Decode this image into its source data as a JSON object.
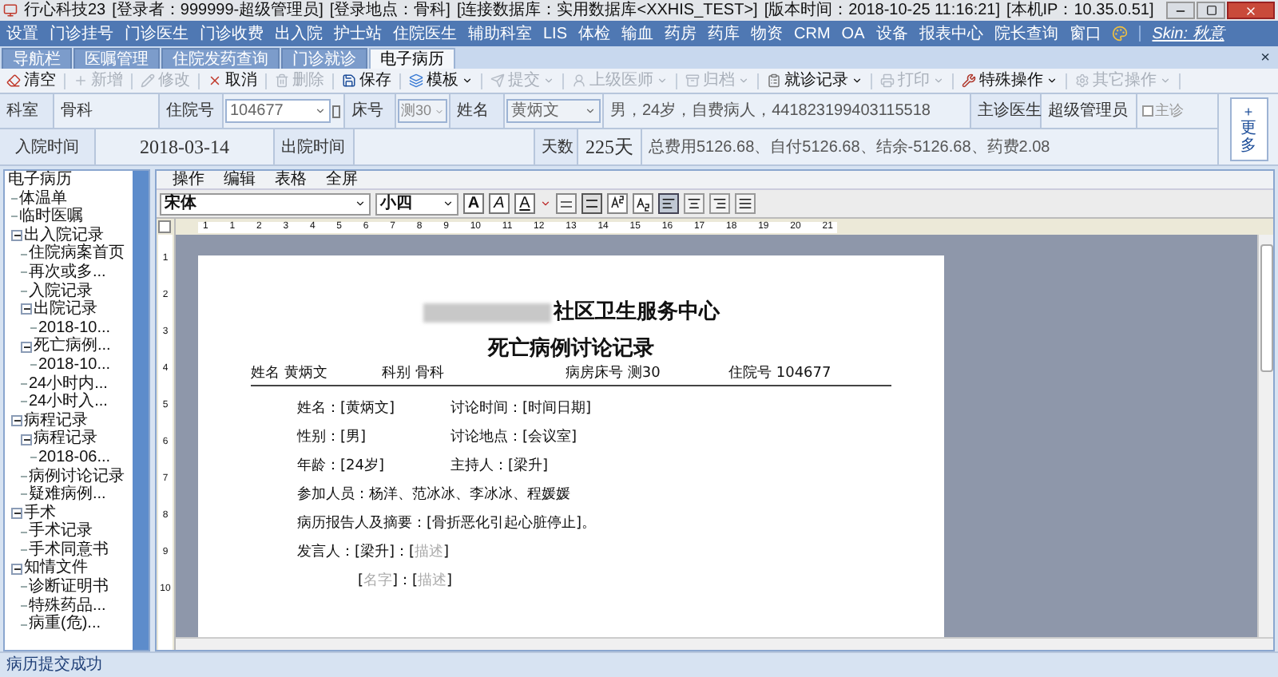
{
  "title_bar": {
    "app": "行心科技23",
    "segments": [
      "[登录者：999999-超级管理员]",
      "[登录地点：骨科]",
      "[连接数据库：实用数据库<XXHIS_TEST>]",
      "[版本时间：2018-10-25 11:16:21]",
      "[本机IP：10.35.0.51]"
    ]
  },
  "menu": [
    "设置",
    "门诊挂号",
    "门诊医生",
    "门诊收费",
    "出入院",
    "护士站",
    "住院医生",
    "辅助科室",
    "LIS",
    "体检",
    "输血",
    "药房",
    "药库",
    "物资",
    "CRM",
    "OA",
    "设备",
    "报表中心",
    "院长查询",
    "窗口"
  ],
  "skin": "Skin: 秋意",
  "tabs": [
    {
      "label": "导航栏",
      "selected": false
    },
    {
      "label": "医嘱管理",
      "selected": false
    },
    {
      "label": "住院发药查询",
      "selected": false
    },
    {
      "label": "门诊就诊",
      "selected": false
    },
    {
      "label": "电子病历",
      "selected": true
    }
  ],
  "tab_close": "×",
  "toolbar": [
    {
      "label": "清空",
      "disabled": false,
      "dropdown": false
    },
    {
      "label": "新增",
      "disabled": true,
      "dropdown": false
    },
    {
      "label": "修改",
      "disabled": true,
      "dropdown": false
    },
    {
      "label": "取消",
      "disabled": false,
      "dropdown": false
    },
    {
      "label": "删除",
      "disabled": true,
      "dropdown": false
    },
    {
      "label": "保存",
      "disabled": false,
      "dropdown": false
    },
    {
      "label": "模板",
      "disabled": false,
      "dropdown": true
    },
    {
      "label": "提交",
      "disabled": true,
      "dropdown": true
    },
    {
      "label": "上级医师",
      "disabled": true,
      "dropdown": true
    },
    {
      "label": "归档",
      "disabled": true,
      "dropdown": true
    },
    {
      "label": "就诊记录",
      "disabled": false,
      "dropdown": true
    },
    {
      "label": "打印",
      "disabled": true,
      "dropdown": true
    },
    {
      "label": "特殊操作",
      "disabled": false,
      "dropdown": true
    },
    {
      "label": "其它操作",
      "disabled": true,
      "dropdown": true
    }
  ],
  "patient": {
    "dept_label": "科室",
    "dept": "骨科",
    "inpatient_no_label": "住院号",
    "inpatient_no": "104677",
    "bed_label": "床号",
    "bed": "测30",
    "name_label": "姓名",
    "name": "黄炳文",
    "summary": "男，24岁，自费病人，441823199403115518",
    "doctor_label": "主诊医生",
    "doctor": "超级管理员",
    "main_checkbox": {
      "label": "主诊",
      "checked": false
    },
    "admit_label": "入院时间",
    "admit_date": "2018-03-14",
    "discharge_label": "出院时间",
    "days_label": "天数",
    "days": "225天",
    "fees": "总费用5126.68、自付5126.68、结余-5126.68、药费2.08",
    "more_plus": "+",
    "more_label": "更多"
  },
  "tree": [
    {
      "label": "电子病历",
      "children": [
        {
          "label": "体温单"
        },
        {
          "label": "临时医嘱"
        },
        {
          "label": "出入院记录",
          "expanded": true,
          "children": [
            {
              "label": "住院病案首页"
            },
            {
              "label": "再次或多..."
            },
            {
              "label": "入院记录"
            },
            {
              "label": "出院记录",
              "expanded": true,
              "children": [
                {
                  "label": "2018-10..."
                }
              ]
            },
            {
              "label": "死亡病例...",
              "expanded": true,
              "children": [
                {
                  "label": "2018-10..."
                }
              ]
            },
            {
              "label": "24小时内..."
            },
            {
              "label": "24小时入..."
            }
          ]
        },
        {
          "label": "病程记录",
          "expanded": true,
          "children": [
            {
              "label": "病程记录",
              "expanded": true,
              "children": [
                {
                  "label": "2018-06..."
                }
              ]
            },
            {
              "label": "病例讨论记录"
            },
            {
              "label": "疑难病例..."
            }
          ]
        },
        {
          "label": "手术",
          "expanded": true,
          "children": [
            {
              "label": "手术记录"
            },
            {
              "label": "手术同意书"
            }
          ]
        },
        {
          "label": "知情文件",
          "expanded": true,
          "children": [
            {
              "label": "诊断证明书"
            },
            {
              "label": "特殊药品..."
            },
            {
              "label": "病重(危)..."
            }
          ]
        }
      ]
    }
  ],
  "editor_menu": [
    "操作",
    "编辑",
    "表格",
    "全屏"
  ],
  "font": "宋体",
  "font_size": "小四",
  "format_buttons": [
    {
      "kind": "bold",
      "label": "A",
      "selected": false
    },
    {
      "kind": "italic",
      "label": "A",
      "selected": false
    },
    {
      "kind": "underline",
      "label": "A",
      "selected": false
    }
  ],
  "align_buttons": [
    {
      "selected": true
    },
    {
      "selected": false
    },
    {
      "selected": false
    },
    {
      "selected": false
    }
  ],
  "ruler": [
    "1",
    "1",
    "2",
    "3",
    "4",
    "5",
    "6",
    "7",
    "8",
    "9",
    "10",
    "11",
    "12",
    "13",
    "14",
    "15",
    "16",
    "17",
    "18",
    "19",
    "20",
    "21"
  ],
  "vruler": [
    "1",
    "2",
    "3",
    "4",
    "5",
    "6",
    "7",
    "8",
    "9",
    "10"
  ],
  "document": {
    "org": "社区卫生服务中心",
    "title": "死亡病例讨论记录",
    "header": [
      {
        "label": "姓名",
        "value": "黄炳文"
      },
      {
        "label": "科别",
        "value": "骨科"
      },
      {
        "label": "病房床号",
        "value": "测30"
      },
      {
        "label": "住院号",
        "value": "104677"
      }
    ],
    "lines": [
      {
        "indented": false,
        "cells": [
          [
            {
              "text": "姓名：[黄炳文]",
              "placeholder": false
            }
          ],
          [
            {
              "text": "讨论时间：[时间日期]",
              "placeholder": false
            }
          ]
        ]
      },
      {
        "indented": false,
        "cells": [
          [
            {
              "text": "性别：[男]",
              "placeholder": false
            }
          ],
          [
            {
              "text": "讨论地点：[会议室]",
              "placeholder": false
            }
          ]
        ]
      },
      {
        "indented": false,
        "cells": [
          [
            {
              "text": "年龄：[24岁]",
              "placeholder": false
            }
          ],
          [
            {
              "text": "主持人：[梁升]",
              "placeholder": false
            }
          ]
        ]
      },
      {
        "indented": false,
        "cells": [
          [
            {
              "text": "参加人员：杨洋、范冰冰、李冰冰、程媛媛",
              "placeholder": false
            }
          ]
        ]
      },
      {
        "indented": false,
        "cells": [
          [
            {
              "text": "病历报告人及摘要：[骨折恶化引起心脏停止]。",
              "placeholder": false
            }
          ]
        ]
      },
      {
        "indented": false,
        "cells": [
          [
            {
              "text": "发言人：[梁升]：[",
              "placeholder": false
            },
            {
              "text": "描述",
              "placeholder": true
            },
            {
              "text": "]",
              "placeholder": false
            }
          ]
        ]
      },
      {
        "indented": true,
        "cells": [
          [
            {
              "text": "[",
              "placeholder": false
            },
            {
              "text": "名字",
              "placeholder": true
            },
            {
              "text": "]：[",
              "placeholder": false
            },
            {
              "text": "描述",
              "placeholder": true
            },
            {
              "text": "]",
              "placeholder": false
            }
          ]
        ]
      }
    ]
  },
  "status": "病历提交成功"
}
